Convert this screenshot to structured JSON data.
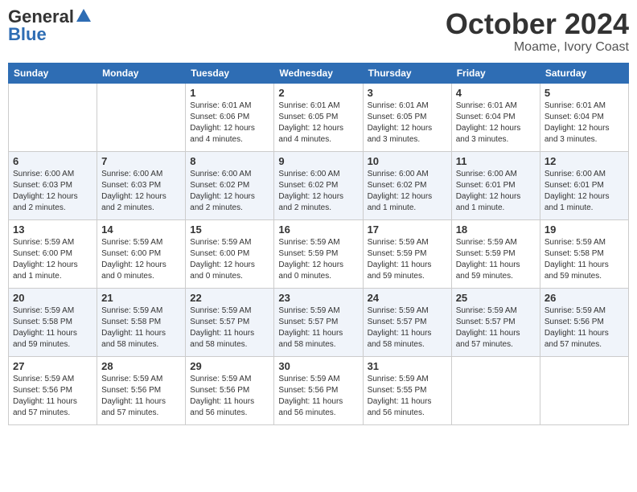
{
  "header": {
    "logo_general": "General",
    "logo_blue": "Blue",
    "month_title": "October 2024",
    "location": "Moame, Ivory Coast"
  },
  "days_of_week": [
    "Sunday",
    "Monday",
    "Tuesday",
    "Wednesday",
    "Thursday",
    "Friday",
    "Saturday"
  ],
  "weeks": [
    [
      {
        "day": "",
        "content": ""
      },
      {
        "day": "",
        "content": ""
      },
      {
        "day": "1",
        "content": "Sunrise: 6:01 AM\nSunset: 6:06 PM\nDaylight: 12 hours and 4 minutes."
      },
      {
        "day": "2",
        "content": "Sunrise: 6:01 AM\nSunset: 6:05 PM\nDaylight: 12 hours and 4 minutes."
      },
      {
        "day": "3",
        "content": "Sunrise: 6:01 AM\nSunset: 6:05 PM\nDaylight: 12 hours and 3 minutes."
      },
      {
        "day": "4",
        "content": "Sunrise: 6:01 AM\nSunset: 6:04 PM\nDaylight: 12 hours and 3 minutes."
      },
      {
        "day": "5",
        "content": "Sunrise: 6:01 AM\nSunset: 6:04 PM\nDaylight: 12 hours and 3 minutes."
      }
    ],
    [
      {
        "day": "6",
        "content": "Sunrise: 6:00 AM\nSunset: 6:03 PM\nDaylight: 12 hours and 2 minutes."
      },
      {
        "day": "7",
        "content": "Sunrise: 6:00 AM\nSunset: 6:03 PM\nDaylight: 12 hours and 2 minutes."
      },
      {
        "day": "8",
        "content": "Sunrise: 6:00 AM\nSunset: 6:02 PM\nDaylight: 12 hours and 2 minutes."
      },
      {
        "day": "9",
        "content": "Sunrise: 6:00 AM\nSunset: 6:02 PM\nDaylight: 12 hours and 2 minutes."
      },
      {
        "day": "10",
        "content": "Sunrise: 6:00 AM\nSunset: 6:02 PM\nDaylight: 12 hours and 1 minute."
      },
      {
        "day": "11",
        "content": "Sunrise: 6:00 AM\nSunset: 6:01 PM\nDaylight: 12 hours and 1 minute."
      },
      {
        "day": "12",
        "content": "Sunrise: 6:00 AM\nSunset: 6:01 PM\nDaylight: 12 hours and 1 minute."
      }
    ],
    [
      {
        "day": "13",
        "content": "Sunrise: 5:59 AM\nSunset: 6:00 PM\nDaylight: 12 hours and 1 minute."
      },
      {
        "day": "14",
        "content": "Sunrise: 5:59 AM\nSunset: 6:00 PM\nDaylight: 12 hours and 0 minutes."
      },
      {
        "day": "15",
        "content": "Sunrise: 5:59 AM\nSunset: 6:00 PM\nDaylight: 12 hours and 0 minutes."
      },
      {
        "day": "16",
        "content": "Sunrise: 5:59 AM\nSunset: 5:59 PM\nDaylight: 12 hours and 0 minutes."
      },
      {
        "day": "17",
        "content": "Sunrise: 5:59 AM\nSunset: 5:59 PM\nDaylight: 11 hours and 59 minutes."
      },
      {
        "day": "18",
        "content": "Sunrise: 5:59 AM\nSunset: 5:59 PM\nDaylight: 11 hours and 59 minutes."
      },
      {
        "day": "19",
        "content": "Sunrise: 5:59 AM\nSunset: 5:58 PM\nDaylight: 11 hours and 59 minutes."
      }
    ],
    [
      {
        "day": "20",
        "content": "Sunrise: 5:59 AM\nSunset: 5:58 PM\nDaylight: 11 hours and 59 minutes."
      },
      {
        "day": "21",
        "content": "Sunrise: 5:59 AM\nSunset: 5:58 PM\nDaylight: 11 hours and 58 minutes."
      },
      {
        "day": "22",
        "content": "Sunrise: 5:59 AM\nSunset: 5:57 PM\nDaylight: 11 hours and 58 minutes."
      },
      {
        "day": "23",
        "content": "Sunrise: 5:59 AM\nSunset: 5:57 PM\nDaylight: 11 hours and 58 minutes."
      },
      {
        "day": "24",
        "content": "Sunrise: 5:59 AM\nSunset: 5:57 PM\nDaylight: 11 hours and 58 minutes."
      },
      {
        "day": "25",
        "content": "Sunrise: 5:59 AM\nSunset: 5:57 PM\nDaylight: 11 hours and 57 minutes."
      },
      {
        "day": "26",
        "content": "Sunrise: 5:59 AM\nSunset: 5:56 PM\nDaylight: 11 hours and 57 minutes."
      }
    ],
    [
      {
        "day": "27",
        "content": "Sunrise: 5:59 AM\nSunset: 5:56 PM\nDaylight: 11 hours and 57 minutes."
      },
      {
        "day": "28",
        "content": "Sunrise: 5:59 AM\nSunset: 5:56 PM\nDaylight: 11 hours and 57 minutes."
      },
      {
        "day": "29",
        "content": "Sunrise: 5:59 AM\nSunset: 5:56 PM\nDaylight: 11 hours and 56 minutes."
      },
      {
        "day": "30",
        "content": "Sunrise: 5:59 AM\nSunset: 5:56 PM\nDaylight: 11 hours and 56 minutes."
      },
      {
        "day": "31",
        "content": "Sunrise: 5:59 AM\nSunset: 5:55 PM\nDaylight: 11 hours and 56 minutes."
      },
      {
        "day": "",
        "content": ""
      },
      {
        "day": "",
        "content": ""
      }
    ]
  ]
}
